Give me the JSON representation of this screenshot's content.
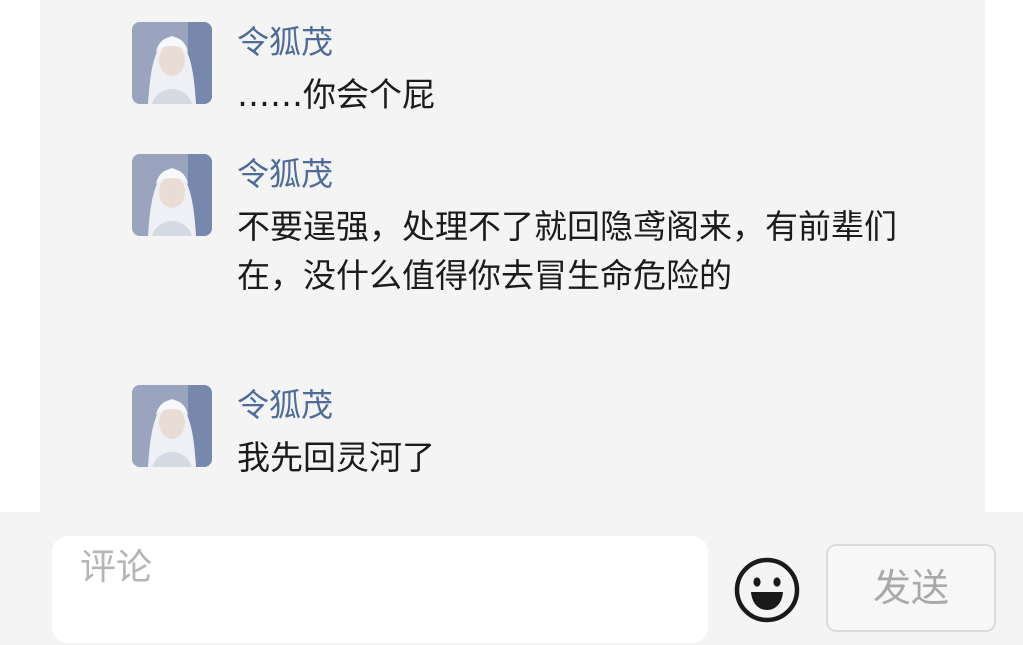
{
  "messages": [
    {
      "sender": "令狐茂",
      "text": "……你会个屁"
    },
    {
      "sender": "令狐茂",
      "text": "不要逞强，处理不了就回隐鸢阁来，有前辈们在，没什么值得你去冒生命危险的"
    },
    {
      "sender": "令狐茂",
      "text": "我先回灵河了"
    }
  ],
  "composer": {
    "placeholder": "评论",
    "emoji_icon": "smiley-face-icon",
    "send_label": "发送"
  },
  "colors": {
    "sender_name": "#4f6b98",
    "feed_background": "#f4f4f4",
    "send_button_text": "#a9a9a9"
  }
}
